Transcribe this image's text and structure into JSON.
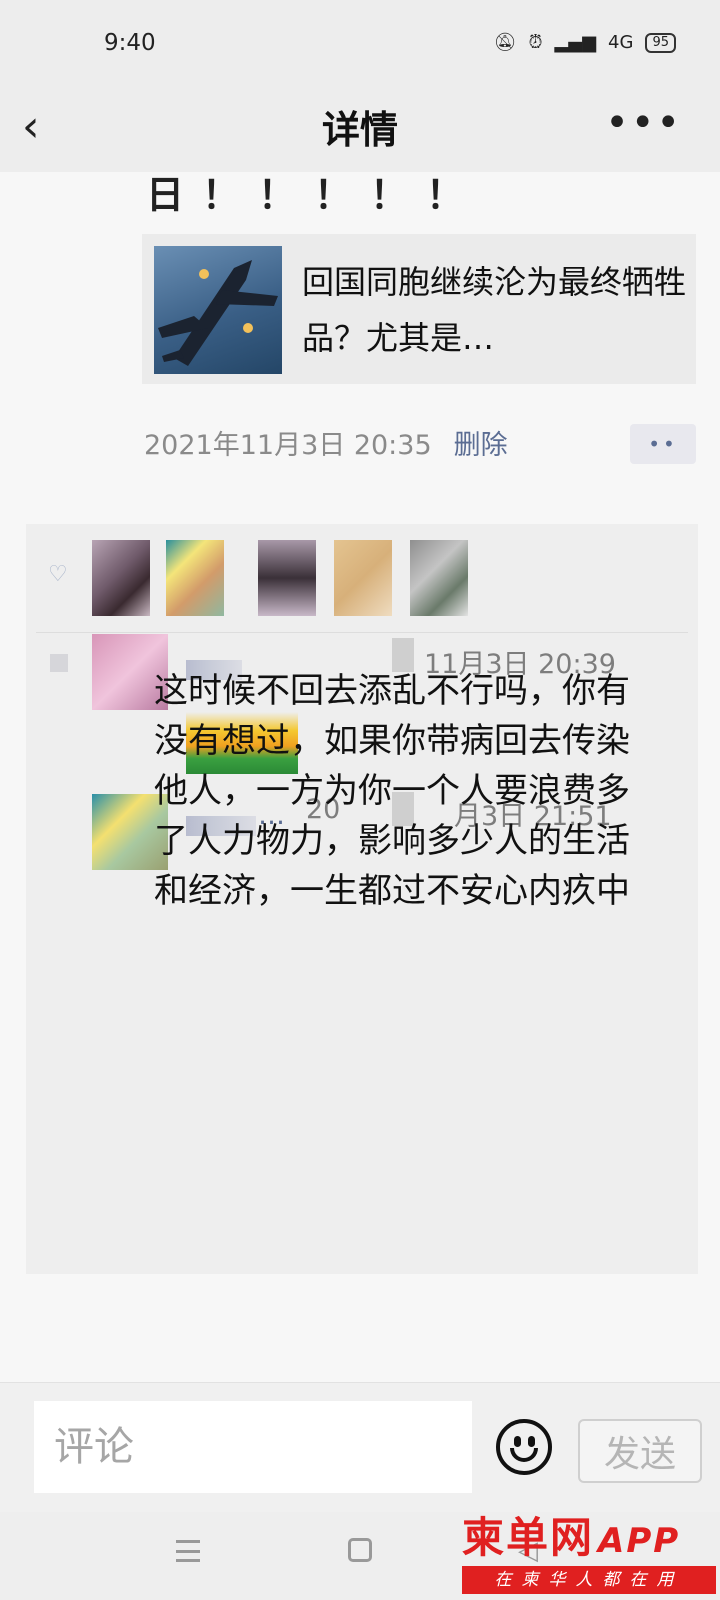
{
  "status_bar": {
    "time": "9:40",
    "signal": "4G",
    "battery": "95"
  },
  "nav": {
    "title": "详情"
  },
  "post": {
    "text_tail": "日！！！！！",
    "link_card": {
      "title": "回国同胞继续沦为最终牺牲品？尤其是…"
    },
    "time": "2021年11月3日 20:35",
    "delete_label": "删除",
    "more_label": "••"
  },
  "comments": [
    {
      "time": "11月3日 20:39"
    },
    {
      "name_tail": "…",
      "time_prefix": "20",
      "time_suffix": "月3日 21:51",
      "text": "这时候不回去添乱不行吗，你有没有想过，如果你带病回去传染他人，一方为你一个人要浪费多了人力物力，影响多少人的生活和经济，一生都过不安心内疚中"
    }
  ],
  "input": {
    "placeholder": "评论",
    "send_label": "发送"
  },
  "watermark": {
    "logo": "柬单网",
    "app": "APP",
    "slogan": "在柬华人都在用"
  },
  "colors": {
    "link_blue": "#5b6d93",
    "watermark_red": "#e02020",
    "header_bg": "#ededed"
  }
}
